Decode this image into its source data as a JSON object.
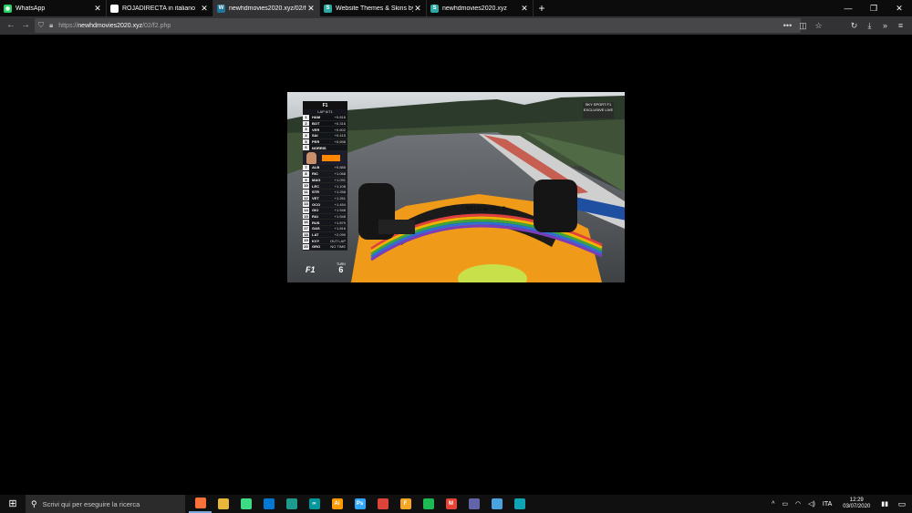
{
  "tabs": [
    {
      "title": "WhatsApp",
      "icon": "whatsapp-icon",
      "color": "#25d366",
      "glyph": "◉",
      "active": false
    },
    {
      "title": "ROJADIRECTA in italiano",
      "icon": "page-icon",
      "color": "#ffffff",
      "glyph": "",
      "active": false
    },
    {
      "title": "newhdmovies2020.xyz/02/f",
      "icon": "wordpress-icon",
      "color": "#21759b",
      "glyph": "W",
      "active": true
    },
    {
      "title": "Website Themes & Skins by Sty",
      "icon": "stylish-icon",
      "color": "#2aa9a3",
      "glyph": "S",
      "active": false
    },
    {
      "title": "newhdmovies2020.xyz",
      "icon": "stylish-icon",
      "color": "#2aa9a3",
      "glyph": "S",
      "active": false
    }
  ],
  "address": {
    "prefix": "https://",
    "host": "newhdmovies2020.xyz",
    "path": "/02/f2.php"
  },
  "video": {
    "tower_header": "F1",
    "lap": "LAP 6/71",
    "drivers_top": [
      {
        "pos": "1",
        "name": "HAM",
        "gap": "+0.816"
      },
      {
        "pos": "2",
        "name": "BOT",
        "gap": "+0.316"
      },
      {
        "pos": "3",
        "name": "VER",
        "gap": "+0.602"
      },
      {
        "pos": "4",
        "name": "SAI",
        "gap": "+0.415"
      },
      {
        "pos": "5",
        "name": "PER",
        "gap": "+0.698"
      },
      {
        "pos": "6",
        "name": "NORRIS",
        "gap": ""
      }
    ],
    "drivers_bottom": [
      {
        "pos": "7",
        "name": "ALB",
        "gap": "+0.885"
      },
      {
        "pos": "8",
        "name": "RIC",
        "gap": "+1.068"
      },
      {
        "pos": "9",
        "name": "MAG",
        "gap": "+1.091"
      },
      {
        "pos": "10",
        "name": "LEC",
        "gap": "+1.108"
      },
      {
        "pos": "11",
        "name": "STR",
        "gap": "+1.258"
      },
      {
        "pos": "12",
        "name": "VET",
        "gap": "+1.261"
      },
      {
        "pos": "13",
        "name": "OCO",
        "gap": "+1.454"
      },
      {
        "pos": "14",
        "name": "GIO",
        "gap": "+1.548"
      },
      {
        "pos": "15",
        "name": "RAI",
        "gap": "+1.548"
      },
      {
        "pos": "16",
        "name": "RUS",
        "gap": "+1.879"
      },
      {
        "pos": "17",
        "name": "GAS",
        "gap": "+1.816"
      },
      {
        "pos": "18",
        "name": "LAT",
        "gap": "+2.090"
      },
      {
        "pos": "19",
        "name": "KVY",
        "gap": "OUT LAP"
      },
      {
        "pos": "20",
        "name": "GRO",
        "gap": "NO TIME"
      }
    ],
    "broadcaster": "SKY SPORT F1 EXCLUSIVE LIVE",
    "bottom_logo": "F1",
    "turn_label": "TURN",
    "turn_number": "6",
    "car_text": "VELO ▶ VELO"
  },
  "taskbar": {
    "search_placeholder": "Scrivi qui per eseguire la ricerca",
    "apps": [
      {
        "name": "firefox-icon",
        "color": "#ff7139",
        "glyph": "",
        "running": true
      },
      {
        "name": "file-explorer-icon",
        "color": "#e8b63b",
        "glyph": "",
        "running": false
      },
      {
        "name": "android-studio-icon",
        "color": "#3ddc84",
        "glyph": "",
        "running": false
      },
      {
        "name": "vscode-icon",
        "color": "#0078d4",
        "glyph": "",
        "running": false
      },
      {
        "name": "app-icon",
        "color": "#1c9c8c",
        "glyph": "",
        "running": false
      },
      {
        "name": "arduino-icon",
        "color": "#00979d",
        "glyph": "∞",
        "running": false
      },
      {
        "name": "illustrator-icon",
        "color": "#ff9a00",
        "glyph": "Ai",
        "running": false
      },
      {
        "name": "photoshop-icon",
        "color": "#31a8ff",
        "glyph": "Ps",
        "running": false
      },
      {
        "name": "chrome-icon",
        "color": "#db4437",
        "glyph": "",
        "running": false
      },
      {
        "name": "fiverr-icon",
        "color": "#f5a623",
        "glyph": "F",
        "running": false
      },
      {
        "name": "spotify-icon",
        "color": "#1db954",
        "glyph": "",
        "running": false
      },
      {
        "name": "gmail-icon",
        "color": "#ea4335",
        "glyph": "M",
        "running": false
      },
      {
        "name": "teams-icon",
        "color": "#6264a7",
        "glyph": "",
        "running": false
      },
      {
        "name": "notepad-icon",
        "color": "#4aa3df",
        "glyph": "",
        "running": false
      },
      {
        "name": "edge-icon",
        "color": "#0fa5b5",
        "glyph": "",
        "running": false
      }
    ],
    "language": "ITA",
    "time": "12:29",
    "date": "03/07/2020"
  }
}
